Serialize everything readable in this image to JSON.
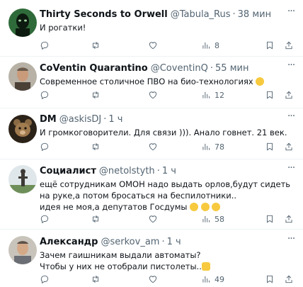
{
  "tweets": [
    {
      "name": "Thirty Seconds to Orwell",
      "handle": "@Tabula_Rus",
      "time": "38 мин",
      "text": "И рогатки!",
      "views": "8",
      "avatar": "orwell-avatar"
    },
    {
      "name": "CoVentin Quarantino",
      "handle": "@CoventinQ",
      "time": "55 мин",
      "text": "Современное столичное ПВО на био-технологиях",
      "emoji": "🤣",
      "views": "12",
      "avatar": "man-avatar"
    },
    {
      "name": "DM",
      "handle": "@askisDJ",
      "time": "1 ч",
      "text": "И громкоговорители. Для связи ))). Анало говнет. 21 век.",
      "views": "78",
      "avatar": "teddy-bear-avatar"
    },
    {
      "name": "Социалист",
      "handle": "@netolstyth",
      "time": "1 ч",
      "text": "ещё сотрудникам ОМОН надо выдать орлов,будут сидеть на руке,а потом бросаться на беспилотники..\nидея не моя,а депутатов Госдумы",
      "emoji": "😆😆😆",
      "views": "58",
      "avatar": "statue-avatar"
    },
    {
      "name": "Александр",
      "handle": "@serkov_am",
      "time": "1 ч",
      "text": "Зачем гаишникам выдали автоматы?\nЧтобы у них не отобрали пистолеты..",
      "emoji": "🤦‍♂️",
      "views": "49",
      "avatar": "man-avatar"
    }
  ],
  "colors": {
    "text": "#0f1419",
    "secondary": "#536471",
    "divider": "#eff3f4",
    "emoji_yellow": "#f7c93e"
  }
}
